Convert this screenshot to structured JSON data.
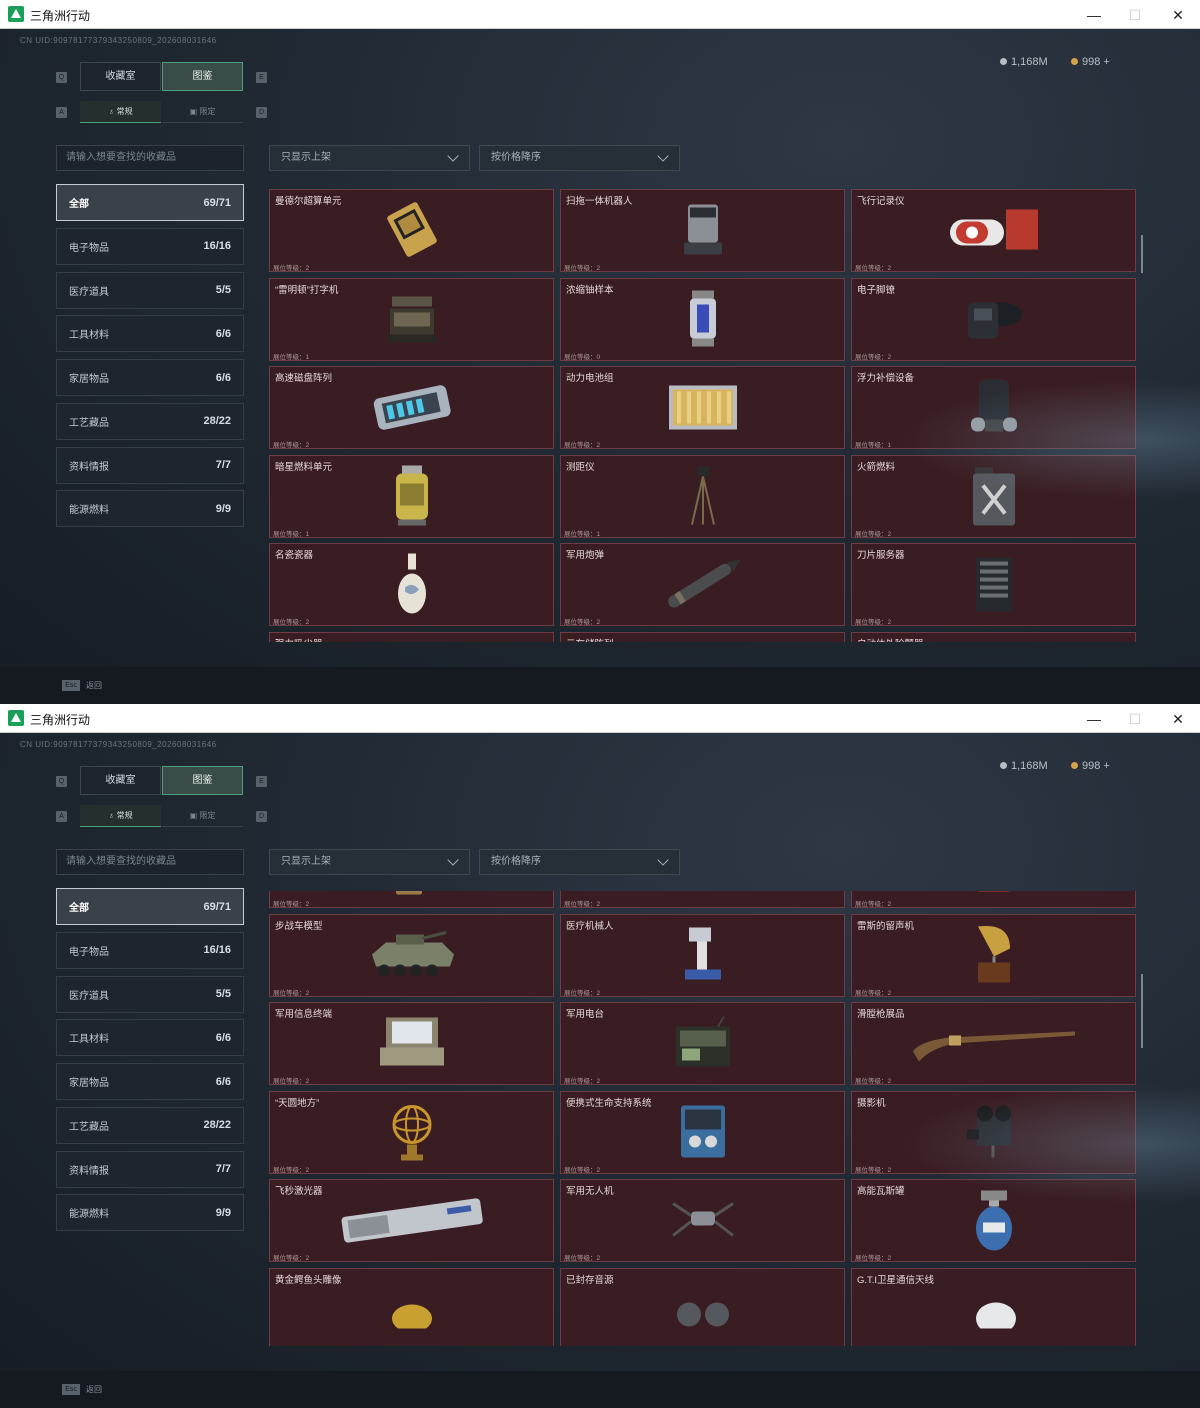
{
  "window": {
    "title": "三角洲行动",
    "minimize": "—",
    "maximize": "☐",
    "close": "✕"
  },
  "uid": "CN UID:9097817737934325080​9_20260803164​6",
  "currency": [
    {
      "value": "1,168M",
      "icon": "silver-coin-icon",
      "color": "#b8bcc2"
    },
    {
      "value": "998 +",
      "icon": "gold-coin-icon",
      "color": "#d6a24a"
    }
  ],
  "key_hints": {
    "tab_left": "Q",
    "tab_right": "E",
    "sub_left": "A",
    "sub_right": "D"
  },
  "main_tabs": [
    {
      "label": "收藏室",
      "active": false
    },
    {
      "label": "图鉴",
      "active": true
    }
  ],
  "sub_tabs": [
    {
      "label": "常规",
      "active": true,
      "icon": "flask-icon"
    },
    {
      "label": "限定",
      "active": false,
      "icon": "frame-icon"
    }
  ],
  "search": {
    "placeholder": "请输入想要查找的收藏品"
  },
  "filters": [
    {
      "label": "只显示上架"
    },
    {
      "label": "按价格降序"
    }
  ],
  "categories": [
    {
      "label": "全部",
      "count": "69/71",
      "active": true
    },
    {
      "label": "电子物品",
      "count": "16/16"
    },
    {
      "label": "医疗道具",
      "count": "5/5"
    },
    {
      "label": "工具材料",
      "count": "6/6"
    },
    {
      "label": "家居物品",
      "count": "6/6"
    },
    {
      "label": "工艺藏品",
      "count": "28/22"
    },
    {
      "label": "资料情报",
      "count": "7/7"
    },
    {
      "label": "能源燃料",
      "count": "9/9"
    }
  ],
  "bottom": {
    "esc_key": "Esc",
    "back_label": "返回"
  },
  "screen1": {
    "items": [
      {
        "name": "曼德尔超算单元",
        "level": "展位等级：2",
        "icon": "chip-icon",
        "color": "#c9a24e"
      },
      {
        "name": "扫拖一体机器人",
        "level": "展位等级：2",
        "icon": "robot-vacuum-icon",
        "color": "#8a9096"
      },
      {
        "name": "飞行记录仪",
        "level": "展位等级：2",
        "icon": "flight-recorder-icon",
        "color": "#c23a30"
      },
      {
        "name": "“雷明顿”打字机",
        "level": "展位等级：1",
        "icon": "typewriter-icon",
        "color": "#3e3a30"
      },
      {
        "name": "浓缩铀样本",
        "level": "展位等级：0",
        "icon": "uranium-canister-icon",
        "color": "#c8ccd6"
      },
      {
        "name": "电子脚镣",
        "level": "展位等级：2",
        "icon": "ankle-monitor-icon",
        "color": "#2c3036"
      },
      {
        "name": "高速磁盘阵列",
        "level": "展位等级：2",
        "icon": "disk-array-icon",
        "color": "#a9b3bd"
      },
      {
        "name": "动力电池组",
        "level": "展位等级：2",
        "icon": "battery-pack-icon",
        "color": "#d8b45a"
      },
      {
        "name": "浮力补偿设备",
        "level": "展位等级：1",
        "icon": "buoyancy-device-icon",
        "color": "#2a2e34"
      },
      {
        "name": "暗星燃料单元",
        "level": "展位等级：1",
        "icon": "fuel-cell-icon",
        "color": "#c9b64a"
      },
      {
        "name": "测距仪",
        "level": "展位等级：1",
        "icon": "rangefinder-icon",
        "color": "#7a6a4a"
      },
      {
        "name": "火箭燃料",
        "level": "展位等级：2",
        "icon": "fuel-can-icon",
        "color": "#55595e"
      },
      {
        "name": "名瓷瓷器",
        "level": "展位等级：2",
        "icon": "porcelain-vase-icon",
        "color": "#e6e2d6"
      },
      {
        "name": "军用炮弹",
        "level": "展位等级：2",
        "icon": "shell-icon",
        "color": "#4a4c4e"
      },
      {
        "name": "刀片服务器",
        "level": "展位等级：2",
        "icon": "server-icon",
        "color": "#26292d"
      },
      {
        "name": "强力吸尘器",
        "level": "",
        "icon": "",
        "color": "#5a4a3a"
      },
      {
        "name": "云存储阵列",
        "level": "",
        "icon": "",
        "color": "#8a9096"
      },
      {
        "name": "自动体外除颤器",
        "level": "",
        "icon": "",
        "color": "#b33a30"
      }
    ]
  },
  "screen2": {
    "items": [
      {
        "name": "",
        "level": "展位等级：2",
        "icon": "vacuum-cleaner-icon",
        "color": "#9c7a4a"
      },
      {
        "name": "",
        "level": "展位等级：2",
        "icon": "storage-array-icon",
        "color": "#b8bec4"
      },
      {
        "name": "",
        "level": "展位等级：2",
        "icon": "defibrillator-icon",
        "color": "#c0392b"
      },
      {
        "name": "步战车模型",
        "level": "展位等级：2",
        "icon": "ifv-model-icon",
        "color": "#7b8068"
      },
      {
        "name": "医疗机械人",
        "level": "展位等级：2",
        "icon": "medical-robot-icon",
        "color": "#c8ccd2"
      },
      {
        "name": "雷斯的留声机",
        "level": "展位等级：2",
        "icon": "gramophone-icon",
        "color": "#c9a040"
      },
      {
        "name": "军用信息终端",
        "level": "展位等级：2",
        "icon": "field-terminal-icon",
        "color": "#a09a80"
      },
      {
        "name": "军用电台",
        "level": "展位等级：2",
        "icon": "military-radio-icon",
        "color": "#56604c"
      },
      {
        "name": "滑膛枪展品",
        "level": "展位等级：2",
        "icon": "musket-icon",
        "color": "#7a5a36"
      },
      {
        "name": "“天圆地方”",
        "level": "展位等级：2",
        "icon": "armillary-sphere-icon",
        "color": "#c8962c"
      },
      {
        "name": "便携式生命支持系统",
        "level": "展位等级：2",
        "icon": "life-support-icon",
        "color": "#3a6e9e"
      },
      {
        "name": "摄影机",
        "level": "展位等级：2",
        "icon": "camera-icon",
        "color": "#2a2c30"
      },
      {
        "name": "飞秒激光器",
        "level": "展位等级：2",
        "icon": "laser-icon",
        "color": "#c0c6cc"
      },
      {
        "name": "军用无人机",
        "level": "展位等级：2",
        "icon": "drone-icon",
        "color": "#8c9096"
      },
      {
        "name": "高能瓦斯罐",
        "level": "展位等级：2",
        "icon": "gas-tank-icon",
        "color": "#3d6fb0"
      },
      {
        "name": "黄金鳄鱼头雕像",
        "level": "",
        "icon": "crocodile-statue-icon",
        "color": "#c8a030"
      },
      {
        "name": "已封存音源",
        "level": "",
        "icon": "reel-icon",
        "color": "#55585c"
      },
      {
        "name": "G.T.I卫星通信天线",
        "level": "",
        "icon": "satellite-dish-icon",
        "color": "#e6e8ea"
      }
    ]
  }
}
